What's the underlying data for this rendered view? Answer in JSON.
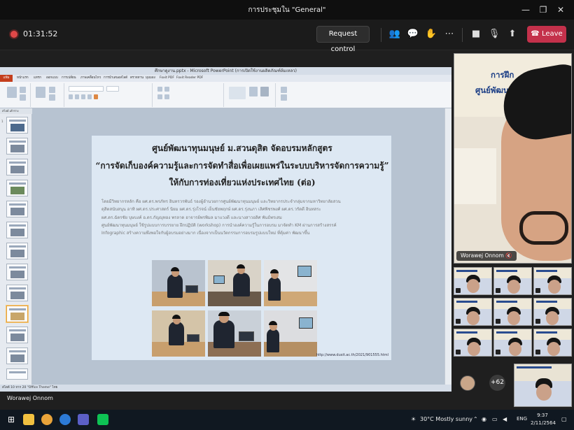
{
  "window": {
    "title": "การประชุมใน \"General\""
  },
  "meeting": {
    "timer": "01:31:52",
    "request_control_label": "Request control",
    "leave_label": "Leave",
    "presenter_name": "Worawej Onnom",
    "participant_overflow": "+62"
  },
  "ppt": {
    "window_title": "ศึกษาดูงาน.pptx - Microsoft PowerPoint (การเปิดใช้งานผลิตภัณฑ์ล้มเหลว)",
    "tabs": [
      "แฟ้ม",
      "หน้าแรก",
      "แทรก",
      "ออกแบบ",
      "การเปลี่ยน",
      "ภาพเคลื่อนไหว",
      "การนำเสนอสไลด์",
      "ตรวจทาน",
      "มุมมอง",
      "Foxit PDF",
      "Foxit Reader PDF"
    ],
    "left_tabs": "สไลด์     เค้าร่าง",
    "status": "สไลด์ 10 จาก 20    \"Office Theme\"    ไทย"
  },
  "slide": {
    "heading_line1": "ศูนย์พัฒนาทุนมนุษย์ ม.สวนดุสิต จัดอบรมหลักสูตร",
    "heading_line2": "“การจัดเก็บองค์ความรู้และการจัดทำสื่อเพื่อเผยแพร่ในระบบบริหารจัดการความรู้”",
    "heading_line3": "ให้กับการท่องเที่ยวแห่งประเทศไทย (ต่อ)",
    "body": "โดยมีวิทยากรหลัก คือ ผศ.ดร.พรภัทร อินทรวรพันธ์ รองผู้อำนวยการศูนย์พัฒนาทุนมนุษย์ และวิทยากรประจำกลุ่มจากมหาวิทยาลัยสวน\nดุสิตสนับสนุน อาทิ ผศ.ดร.ประศาสตร์ นิยม ผศ.ดร.รุ่งโรจน์ เย็นชัยพฤกษ์ ผศ.ดร.รุ่งนภา เลิศพิชรพงศ์ ผศ.ดร.วรัดดี อินทสระ\nผศ.ดร.ฉัตรชัย บุษบงค์ อ.ดร.กัญญุทอง พรลาด อาจารย์พรพิมล มาแวงดี และนางสาวอลิศ พันธ์พรเสม\nศูนย์พัฒนาทุนมนุษย์ ใช้รูปแบบการบรรยาย ฝึกปฏิบัติ (workshop) การนำองค์ความรู้ในการอบรม มาจัดทำ KM ผ่านการสร้างสรรค์\nInfographic สร้างความพึงพอใจกับผู้อบรมอย่างมาก เนื่องจากเป็นนวัตกรรมการอบรมรูปแบบใหม่ ที่คุ้มค่า พัฒนาขึ้น",
    "url": "http://www.dusit.ac.th/2021/901555.html"
  },
  "participant_bg": {
    "line1": "การฝึก",
    "line2": "ศูนย์พัฒนา"
  },
  "taskbar": {
    "weather": "30°C  Mostly sunny",
    "lang": "ENG",
    "time": "9:37",
    "date": "2/11/2564"
  },
  "colors": {
    "leave": "#c4314b",
    "ppt_file_tab": "#c43e1c",
    "recording": "#e04848"
  }
}
